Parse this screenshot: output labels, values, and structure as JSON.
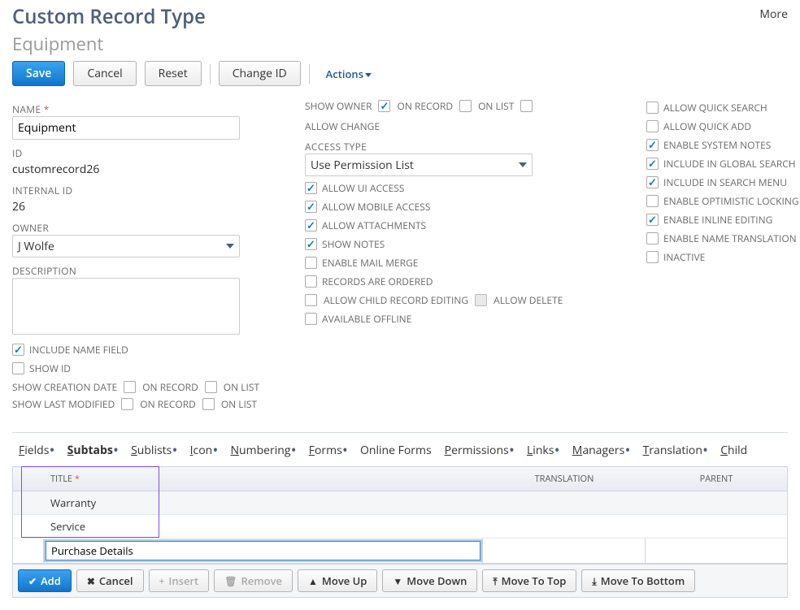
{
  "header": {
    "title": "Custom Record Type",
    "subtitle": "Equipment",
    "more": "More"
  },
  "toolbar": {
    "save": "Save",
    "cancel": "Cancel",
    "reset": "Reset",
    "change_id": "Change ID",
    "actions": "Actions"
  },
  "fields": {
    "name_label": "NAME",
    "name_value": "Equipment",
    "id_label": "ID",
    "id_value": "customrecord26",
    "internal_id_label": "INTERNAL ID",
    "internal_id_value": "26",
    "owner_label": "OWNER",
    "owner_value": "J Wolfe",
    "description_label": "DESCRIPTION",
    "description_value": "",
    "include_name_field": "INCLUDE NAME FIELD",
    "show_id": "SHOW ID",
    "show_creation_date": "SHOW CREATION DATE",
    "show_last_modified": "SHOW LAST MODIFIED",
    "on_record": "ON RECORD",
    "on_list": "ON LIST",
    "show_owner": "SHOW OWNER",
    "allow_change": "ALLOW CHANGE",
    "access_type_label": "ACCESS TYPE",
    "access_type_value": "Use Permission List",
    "allow_ui_access": "ALLOW UI ACCESS",
    "allow_mobile_access": "ALLOW MOBILE ACCESS",
    "allow_attachments": "ALLOW ATTACHMENTS",
    "show_notes": "SHOW NOTES",
    "enable_mail_merge": "ENABLE MAIL MERGE",
    "records_are_ordered": "RECORDS ARE ORDERED",
    "allow_child_record_editing": "ALLOW CHILD RECORD EDITING",
    "allow_delete": "ALLOW DELETE",
    "available_offline": "AVAILABLE OFFLINE",
    "allow_quick_search": "ALLOW QUICK SEARCH",
    "allow_quick_add": "ALLOW QUICK ADD",
    "enable_system_notes": "ENABLE SYSTEM NOTES",
    "include_in_global_search": "INCLUDE IN GLOBAL SEARCH",
    "include_in_search_menu": "INCLUDE IN SEARCH MENU",
    "enable_optimistic_locking": "ENABLE OPTIMISTIC LOCKING",
    "enable_inline_editing": "ENABLE INLINE EDITING",
    "enable_name_translation": "ENABLE NAME TRANSLATION",
    "inactive": "INACTIVE"
  },
  "tabs": {
    "fields": "ields",
    "subtabs": "ubtabs",
    "sublists": "ublists",
    "icon": "con",
    "numbering": "umbering",
    "forms": "orms",
    "online_forms": "Online Forms",
    "permissions": "ermissions",
    "links": "inks",
    "managers": "anagers",
    "translation": "ranslation",
    "child": "hild"
  },
  "grid": {
    "col_title": "TITLE",
    "col_translation": "TRANSLATION",
    "col_parent": "PARENT",
    "rows": [
      {
        "title": "Warranty"
      },
      {
        "title": "Service"
      }
    ],
    "edit_value": "Purchase Details"
  },
  "grid_toolbar": {
    "add": "Add",
    "cancel": "Cancel",
    "insert": "Insert",
    "remove": "Remove",
    "move_up": "Move Up",
    "move_down": "Move Down",
    "move_to_top": "Move To Top",
    "move_to_bottom": "Move To Bottom"
  }
}
